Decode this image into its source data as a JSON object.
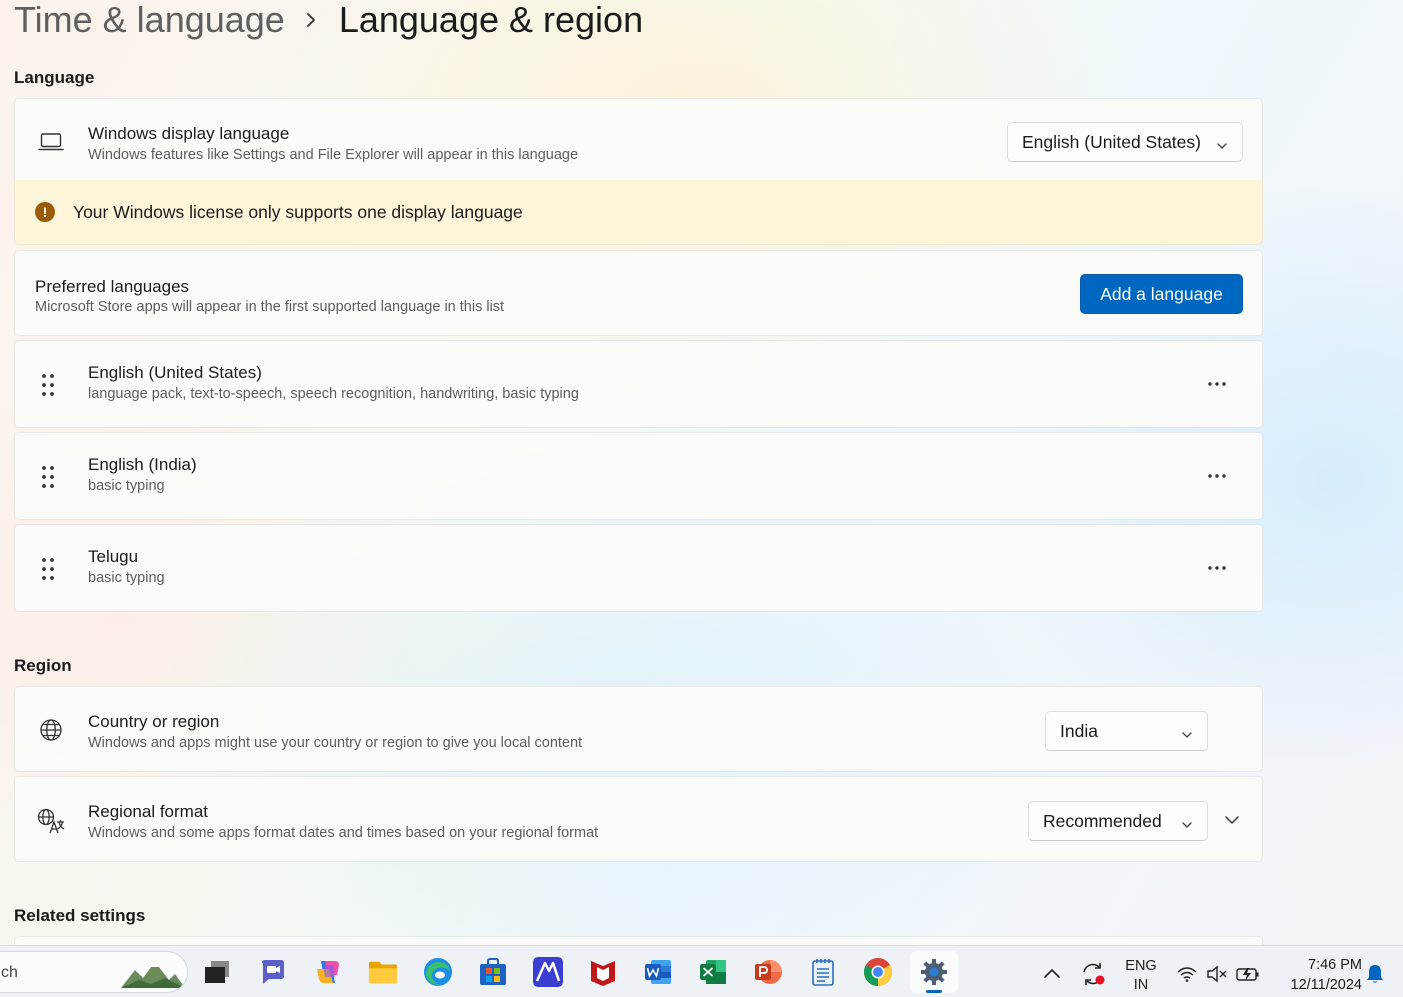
{
  "breadcrumb": {
    "parent": "Time & language",
    "current": "Language & region"
  },
  "language_section": {
    "title": "Language",
    "display_language": {
      "title": "Windows display language",
      "description": "Windows features like Settings and File Explorer will appear in this language",
      "selected": "English (United States)"
    },
    "license_warning": "Your Windows license only supports one display language",
    "preferred": {
      "title": "Preferred languages",
      "description": "Microsoft Store apps will appear in the first supported language in this list",
      "add_button": "Add a language"
    },
    "languages": [
      {
        "name": "English (United States)",
        "features": "language pack, text-to-speech, speech recognition, handwriting, basic typing"
      },
      {
        "name": "English (India)",
        "features": "basic typing"
      },
      {
        "name": "Telugu",
        "features": "basic typing"
      }
    ]
  },
  "region_section": {
    "title": "Region",
    "country": {
      "title": "Country or region",
      "description": "Windows and apps might use your country or region to give you local content",
      "selected": "India"
    },
    "format": {
      "title": "Regional format",
      "description": "Windows and some apps format dates and times based on your regional format",
      "selected": "Recommended"
    }
  },
  "related_settings_title": "Related settings",
  "taskbar": {
    "search_text": "ch",
    "apps": [
      "mountains-widget",
      "file-explorer-dark",
      "teams",
      "copilot",
      "folder",
      "edge",
      "store",
      "meta-app",
      "mcafee",
      "word",
      "excel",
      "powerpoint",
      "notepad",
      "chrome",
      "settings"
    ],
    "tray": {
      "lang_top": "ENG",
      "lang_bottom": "IN",
      "time": "7:46 PM",
      "date": "12/11/2024"
    }
  },
  "colors": {
    "accent": "#0067c0",
    "warning_bg": "#fcf5da",
    "warning_icon": "#9b5a06"
  }
}
